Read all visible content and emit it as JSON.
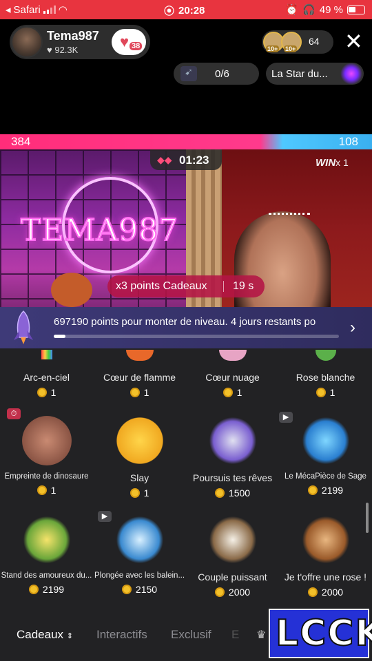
{
  "status_bar": {
    "carrier": "Safari",
    "time": "20:28",
    "battery": "49 %",
    "bg_color": "#e8343f"
  },
  "host": {
    "name": "Tema987",
    "likes": "92.3K",
    "fan_level": "38"
  },
  "viewers": {
    "badges": [
      "10+",
      "10+"
    ],
    "count": "64"
  },
  "goal": {
    "progress": "0/6"
  },
  "star_event": {
    "label": "La Star du..."
  },
  "battle": {
    "left_score": "384",
    "right_score": "108",
    "timer": "01:23",
    "win_label": "WIN",
    "win_count": "x 1",
    "left_share": 0.78
  },
  "overlay": {
    "neon_name": "TEMA987",
    "bonus": "x3 points Cadeaux",
    "bonus_time": "19 s"
  },
  "level_banner": {
    "text": "697190 points pour monter de niveau. 4 jours restants po",
    "progress": 0.04
  },
  "gifts": [
    {
      "name": "Arc-en-ciel",
      "price": "1"
    },
    {
      "name": "Cœur de flamme",
      "price": "1"
    },
    {
      "name": "Cœur nuage",
      "price": "1"
    },
    {
      "name": "Rose blanche",
      "price": "1"
    },
    {
      "name": "Empreinte de dinosaure",
      "price": "1"
    },
    {
      "name": "Slay",
      "price": "1"
    },
    {
      "name": "Poursuis tes rêves",
      "price": "1500"
    },
    {
      "name": "Le MécaPièce de Sage",
      "price": "2199"
    },
    {
      "name": "Stand des amoureux du...",
      "price": "2199"
    },
    {
      "name": "Plongée avec les balein...",
      "price": "2150"
    },
    {
      "name": "Couple puissant",
      "price": "2000"
    },
    {
      "name": "Je t'offre une rose !",
      "price": "2000"
    }
  ],
  "tabs": {
    "gifts": "Cadeaux",
    "interactive": "Interactifs",
    "exclusive": "Exclusif",
    "faded": "E"
  },
  "watermark": {
    "text": "LCCK"
  }
}
